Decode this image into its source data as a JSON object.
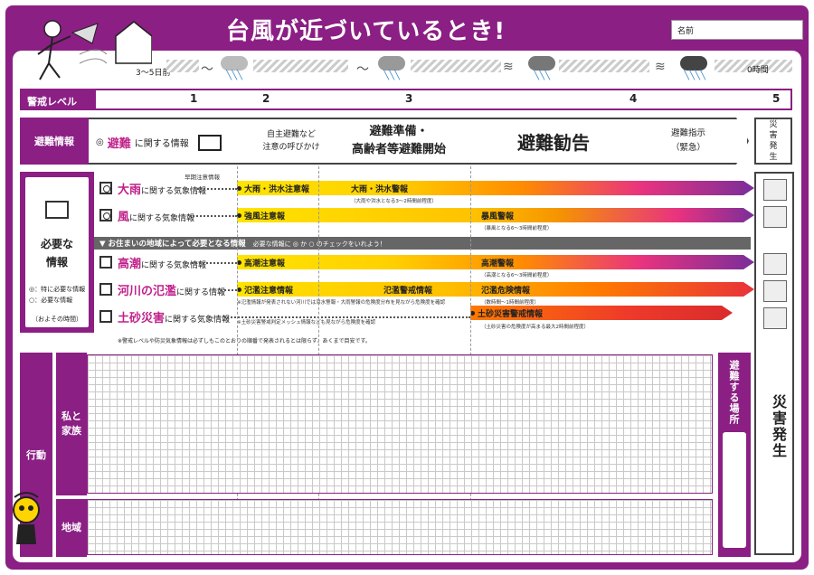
{
  "title": "台風が近づいているとき!",
  "name_label": "名前",
  "timeline": {
    "start": "3～5日前",
    "end": "0時間"
  },
  "levels": {
    "label": "警戒レベル",
    "numbers": [
      "1",
      "2",
      "3",
      "4",
      "5"
    ]
  },
  "evacuation": {
    "label": "避難情報",
    "sub_strong": "避難",
    "sub_rest": "に関する情報",
    "steps": [
      "自主避難など\n注意の呼びかけ",
      "避難準備・\n高齢者等避難開始",
      "避難勧告",
      "避難指示\n（緊急）"
    ],
    "disaster_label": "災\n害\n発\n生"
  },
  "info": {
    "title_line1": "必要な",
    "title_line2": "情報",
    "legend1": "◎：特に必要な情報",
    "legend2": "○：必要な情報",
    "approx": "（およその時間）",
    "early_warning": "早期注意情報",
    "rows": [
      {
        "strong": "大雨",
        "rest": "に関する気象情報",
        "stage1": "大雨・洪水注意報",
        "stage2": "大雨・洪水警報",
        "note": "（大雨や洪水となる3～2時間前程度）"
      },
      {
        "strong": "風",
        "rest": "に関する気象情報",
        "stage1": "強風注意報",
        "stage2": "暴風警報",
        "note": "（暴風となる6～3時間前程度）"
      }
    ],
    "banner": "▼ お住まいの地域によって必要となる情報",
    "banner_note": "必要な情報に ◎ か ○ のチェックをいれよう！",
    "rows2": [
      {
        "strong": "高潮",
        "rest": "に関する気象情報",
        "stage1": "高潮注意報",
        "stage2": "高潮警報",
        "note": "（高潮となる6～3時間前程度）"
      },
      {
        "strong": "河川の氾濫",
        "rest": "に関する情報",
        "stage1": "氾濫注意情報",
        "stage_mid": "氾濫警戒情報",
        "stage2": "氾濫危険情報",
        "note": "（数時間～1時間前程度）",
        "note_mid": "※氾濫情報が発表されない河川では洪水警報・大雨警報の危険度分布を見ながら危険度を確認"
      },
      {
        "strong": "土砂災害",
        "rest": "に関する気象情報",
        "stage2": "土砂災害警戒情報",
        "note": "（土砂災害の危険度が高まる最大2時間前程度）",
        "note_mid": "※土砂災害警戒判定メッシュ情報なども見ながら危険度を確認"
      }
    ],
    "footnote": "※警戒レベルや防災気象情報は必ずしもこのとおりの順番で発表されるとは限らず、あくまで目安です。"
  },
  "action": {
    "label": "行動",
    "family": "私と\n家族",
    "area": "地域",
    "place": "避難する場所",
    "disaster": "災害発生"
  }
}
